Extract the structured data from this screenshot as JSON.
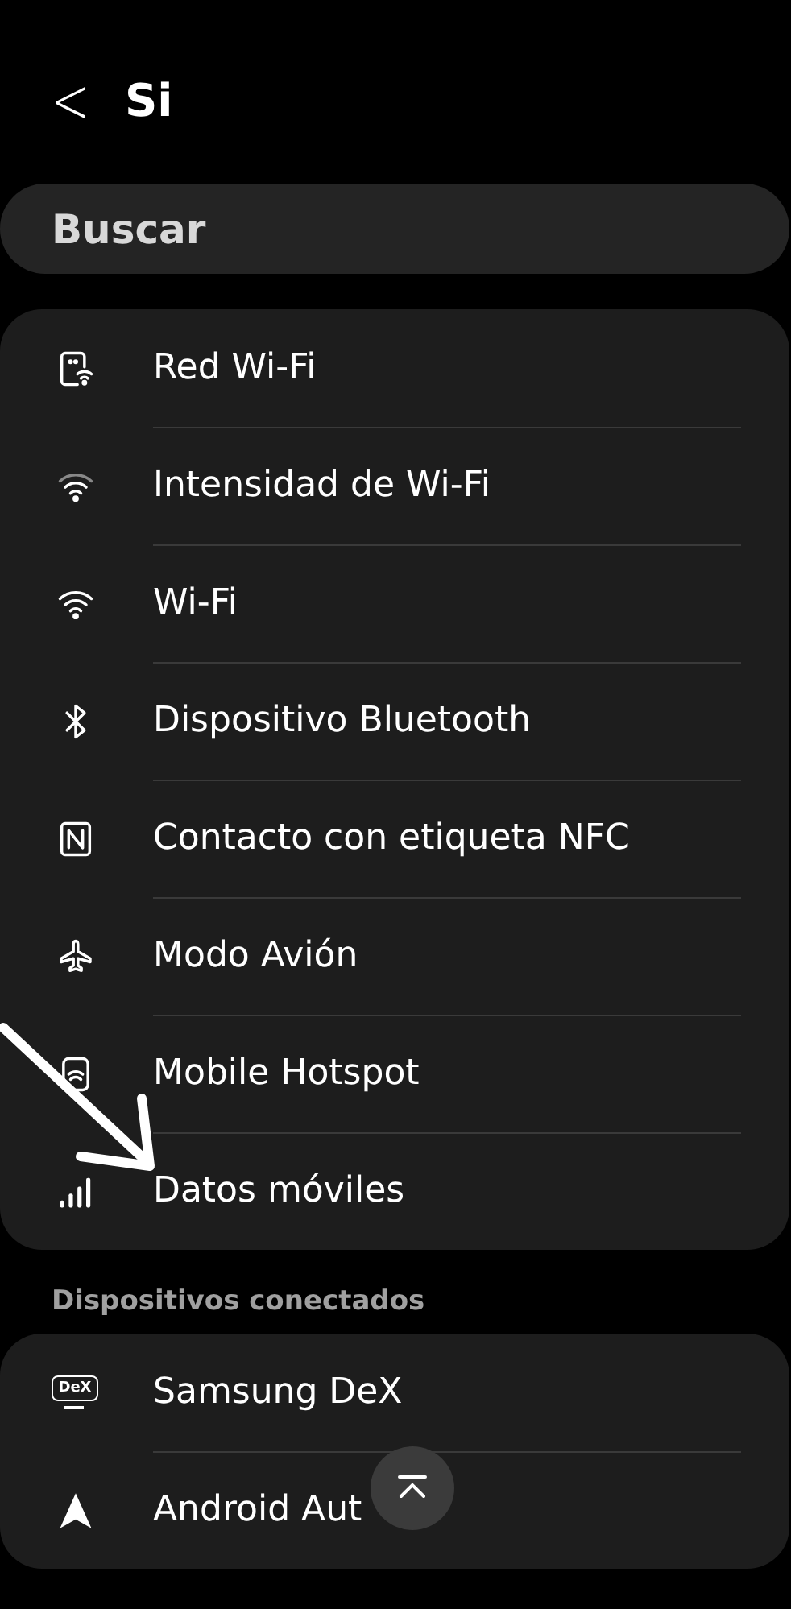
{
  "header": {
    "back": "<",
    "title": "Si"
  },
  "search": {
    "placeholder": "Buscar"
  },
  "results": [
    {
      "kind": "wifi-network",
      "label": "Red Wi-Fi"
    },
    {
      "kind": "wifi-strength",
      "label": "Intensidad de Wi-Fi"
    },
    {
      "kind": "wifi",
      "label": "Wi-Fi"
    },
    {
      "kind": "bluetooth",
      "label": "Dispositivo Bluetooth"
    },
    {
      "kind": "nfc",
      "label": "Contacto con etiqueta NFC"
    },
    {
      "kind": "airplane",
      "label": "Modo Avión"
    },
    {
      "kind": "hotspot",
      "label": "Mobile Hotspot"
    },
    {
      "kind": "signal",
      "label": "Datos móviles"
    }
  ],
  "section": {
    "title": "Dispositivos conectados",
    "items": [
      {
        "kind": "dex",
        "icon_label": "DeX",
        "label": "Samsung DeX"
      },
      {
        "kind": "auto",
        "label": "Android Aut"
      }
    ]
  },
  "annotation": {
    "kind": "arrow"
  }
}
